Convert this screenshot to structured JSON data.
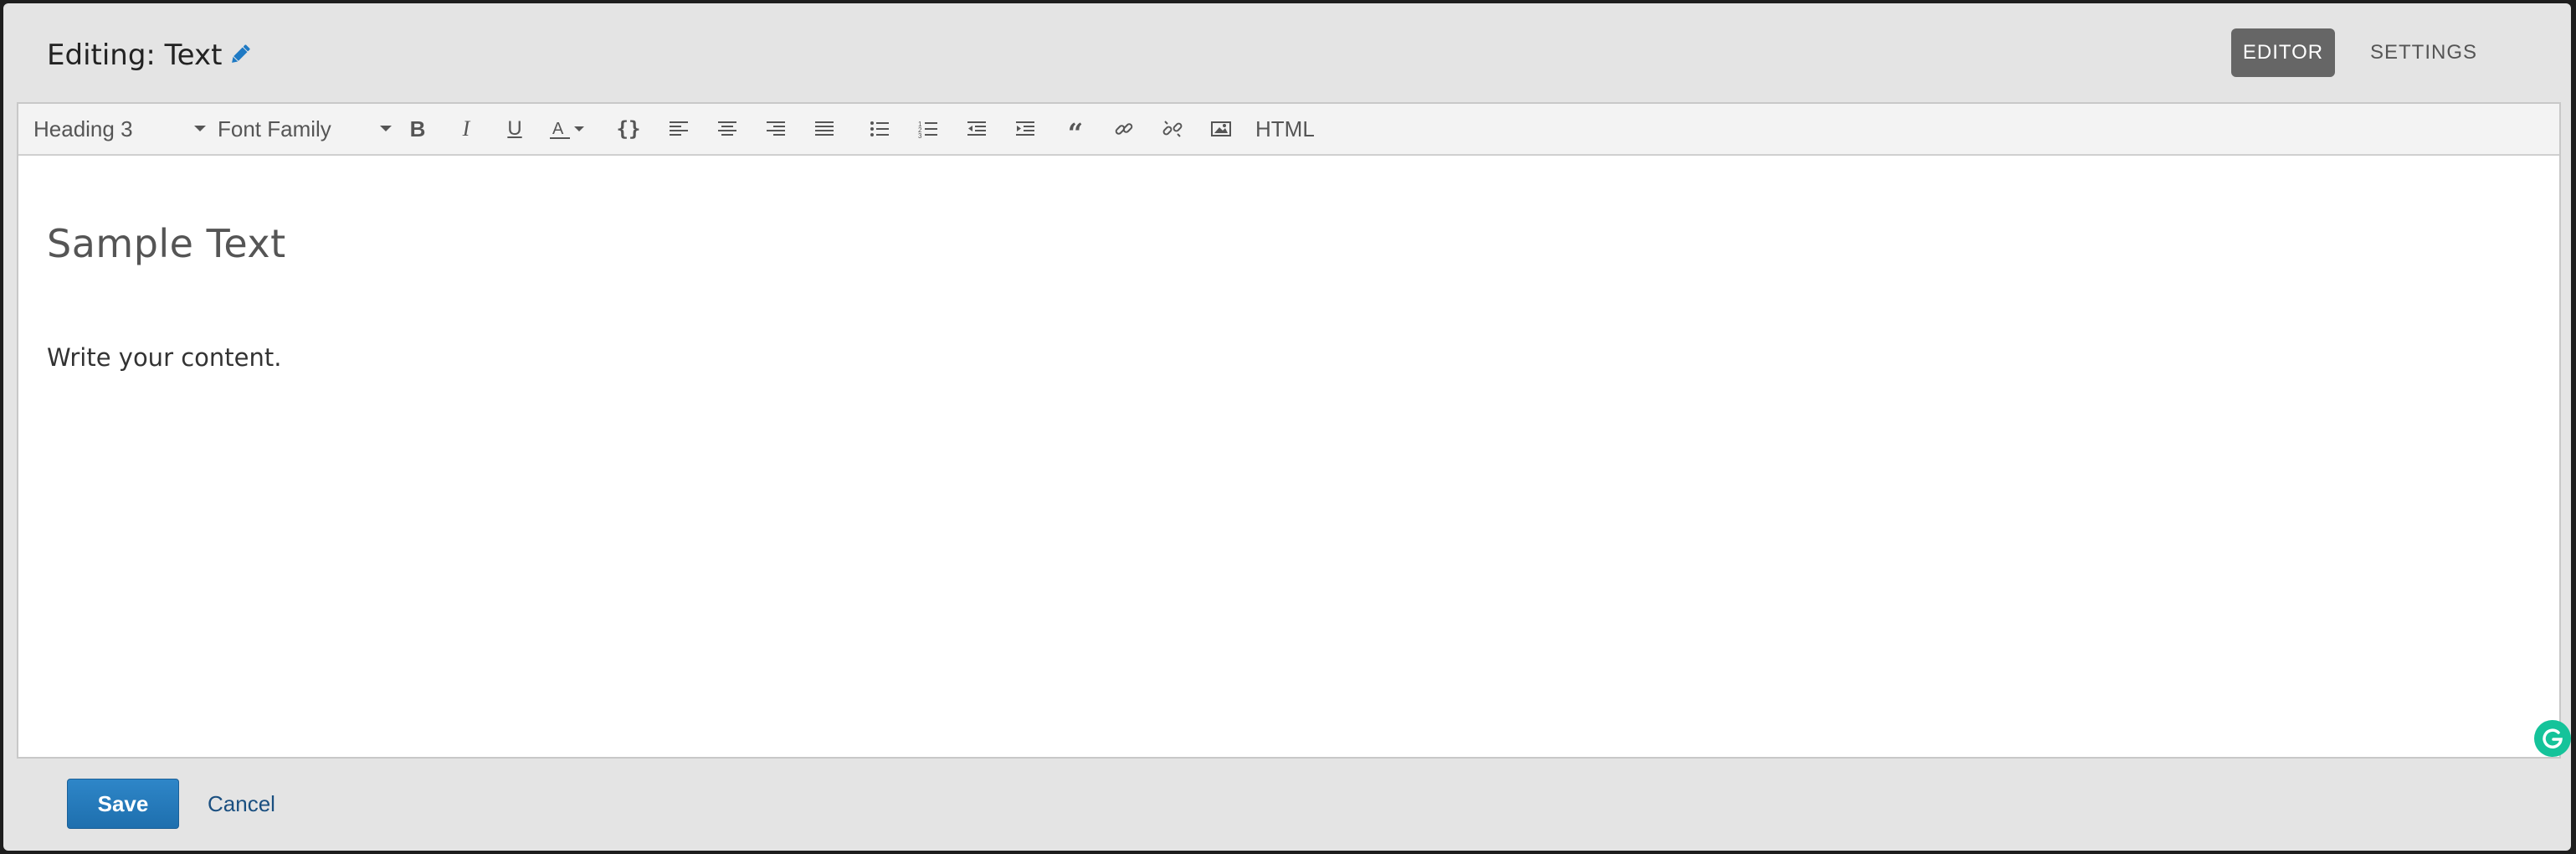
{
  "header": {
    "title": "Editing: Text",
    "tabs": [
      {
        "label": "EDITOR",
        "active": true
      },
      {
        "label": "SETTINGS",
        "active": false
      }
    ]
  },
  "toolbar": {
    "block_format": "Heading 3",
    "font_family": "Font Family",
    "html_label": "HTML",
    "buttons": [
      "bold-icon",
      "italic-icon",
      "underline-icon",
      "text-color-icon",
      "code-icon",
      "align-left-icon",
      "align-center-icon",
      "align-right-icon",
      "align-justify-icon",
      "bullet-list-icon",
      "numbered-list-icon",
      "outdent-icon",
      "indent-icon",
      "blockquote-icon",
      "link-icon",
      "unlink-icon",
      "image-icon"
    ]
  },
  "content": {
    "heading": "Sample Text",
    "paragraph": "Write your content."
  },
  "footer": {
    "save_label": "Save",
    "cancel_label": "Cancel"
  },
  "colors": {
    "accent": "#1e6fae",
    "active_tab": "#666666",
    "grammarly": "#15c39a",
    "edit_icon": "#1f7ac4"
  }
}
